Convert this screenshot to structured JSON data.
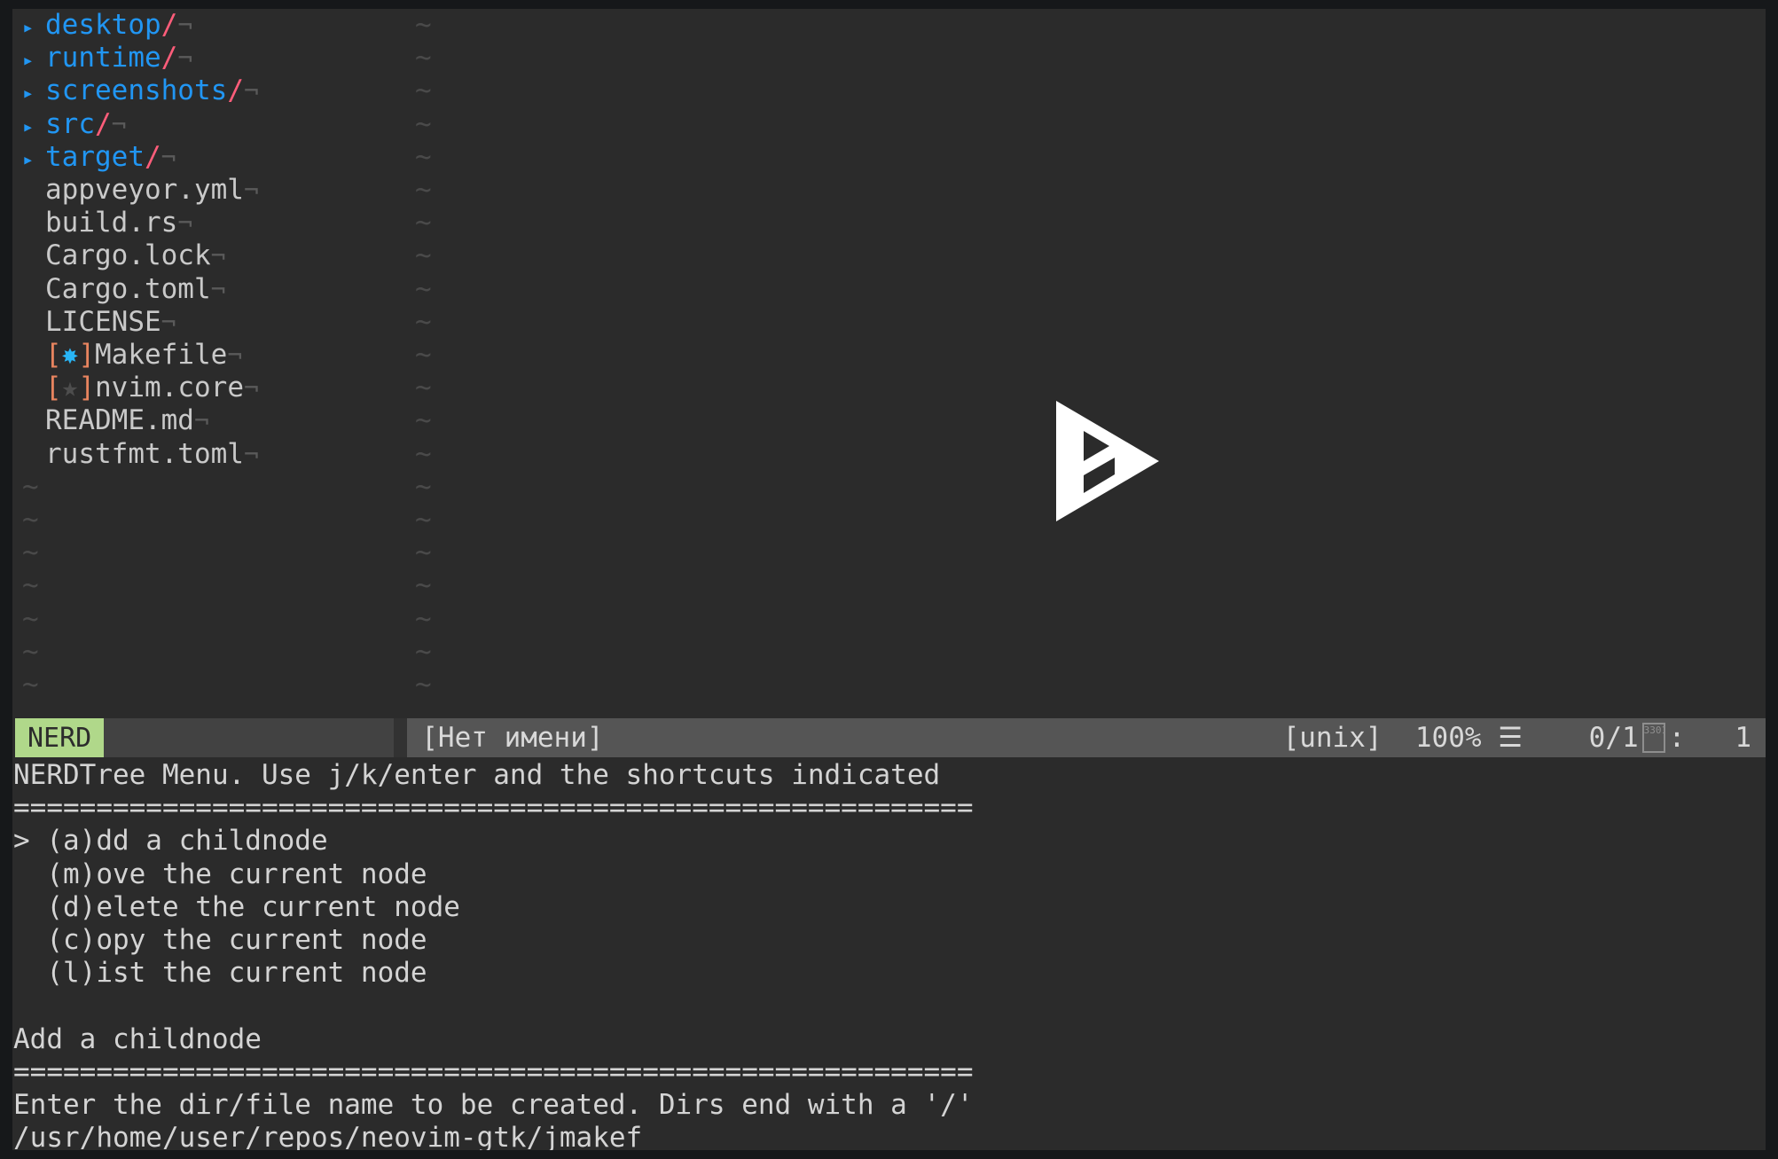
{
  "theme": {
    "frame_bg": "#16181a",
    "editor_bg": "#2b2b2b",
    "fg": "#d4d4d4",
    "dir_blue": "#2196f3",
    "slash_pink": "#ff5d7a",
    "eol_gray": "#5a5a5a",
    "bracket_orange": "#e8845f",
    "mode_badge_bg": "#b0d88a",
    "status_left_bg": "#424242",
    "status_right_bg": "#555555"
  },
  "nerdtree": {
    "pane_name": "NERDTree file explorer",
    "entries": [
      {
        "kind": "dir",
        "arrow": "▸",
        "name": "desktop",
        "slash": "/",
        "eol": "¬"
      },
      {
        "kind": "dir",
        "arrow": "▸",
        "name": "runtime",
        "slash": "/",
        "eol": "¬"
      },
      {
        "kind": "dir",
        "arrow": "▸",
        "name": "screenshots",
        "slash": "/",
        "eol": "¬"
      },
      {
        "kind": "dir",
        "arrow": "▸",
        "name": "src",
        "slash": "/",
        "eol": "¬"
      },
      {
        "kind": "dir",
        "arrow": "▸",
        "name": "target",
        "slash": "/",
        "eol": "¬"
      },
      {
        "kind": "file",
        "name": "appveyor.yml",
        "eol": "¬"
      },
      {
        "kind": "file",
        "name": "build.rs",
        "eol": "¬"
      },
      {
        "kind": "file",
        "name": "Cargo.lock",
        "eol": "¬"
      },
      {
        "kind": "file",
        "name": "Cargo.toml",
        "eol": "¬"
      },
      {
        "kind": "file",
        "name": "LICENSE",
        "eol": "¬"
      },
      {
        "kind": "file",
        "name": "Makefile",
        "eol": "¬",
        "flag_open": "[",
        "flag_close": "]",
        "flag_glyph": "✸",
        "flag_style": "star-blue"
      },
      {
        "kind": "file",
        "name": "nvim.core",
        "eol": "¬",
        "flag_open": "[",
        "flag_close": "]",
        "flag_glyph": "★",
        "flag_style": "star-dim"
      },
      {
        "kind": "file",
        "name": "README.md",
        "eol": "¬"
      },
      {
        "kind": "file",
        "name": "rustfmt.toml",
        "eol": "¬"
      }
    ],
    "filler_marker": "~",
    "filler_count": 7
  },
  "empty_buffer": {
    "pane_name": "unnamed empty buffer",
    "filler_marker": "~",
    "filler_count": 21,
    "logo_name": "neovim-gtk-logo"
  },
  "statusline": {
    "mode": "NERD",
    "buffer_name": "[Нет имени]",
    "fileformat": "[unix]",
    "percent": "100%",
    "lines_icon": "☰",
    "position": "0/1",
    "tofu_glyph": "3301",
    "separator": ":",
    "column": "1"
  },
  "message_area": {
    "lines": [
      "NERDTree Menu. Use j/k/enter and the shortcuts indicated",
      "==========================================================",
      "> (a)dd a childnode",
      "  (m)ove the current node",
      "  (d)elete the current node",
      "  (c)opy the current node",
      "  (l)ist the current node",
      "",
      "Add a childnode",
      "==========================================================",
      "Enter the dir/file name to be created. Dirs end with a '/'",
      "/usr/home/user/repos/neovim-gtk/jmakef"
    ]
  }
}
